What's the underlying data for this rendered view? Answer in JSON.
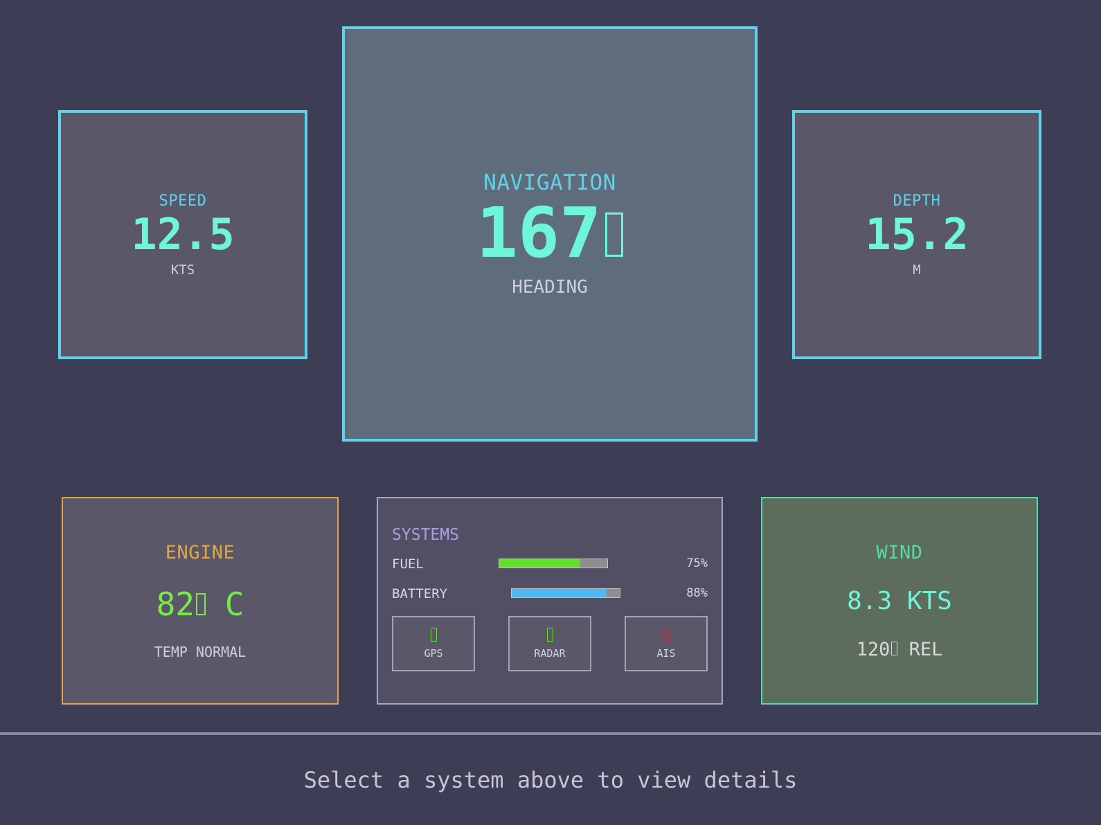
{
  "speed": {
    "label": "SPEED",
    "value": "12.5",
    "unit": "KTS"
  },
  "navigation": {
    "label": "NAVIGATION",
    "value": "167",
    "unit": "HEADING"
  },
  "depth": {
    "label": "DEPTH",
    "value": "15.2",
    "unit": "M"
  },
  "engine": {
    "label": "ENGINE",
    "value_num": "82",
    "value_unit": " C",
    "status": "TEMP NORMAL",
    "accent": "#e0a640"
  },
  "systems": {
    "title": "SYSTEMS",
    "meters": [
      {
        "label": "FUEL",
        "percent_label": "75%",
        "level": 0.75,
        "color": "#5fe12b"
      },
      {
        "label": "BATTERY",
        "percent_label": "88%",
        "level": 0.88,
        "color": "#50b8f0"
      }
    ],
    "statuses": [
      {
        "label": "GPS",
        "icon": "status-ok-icon",
        "color": "#5fe12b"
      },
      {
        "label": "RADAR",
        "icon": "status-ok-icon",
        "color": "#5fe12b"
      },
      {
        "label": "AIS",
        "icon": "status-fault-icon",
        "color": "#c03038"
      }
    ]
  },
  "wind": {
    "label": "WIND",
    "speed": "8.3 KTS",
    "direction_num": "120",
    "direction_suffix": " REL",
    "accent": "#58d9a8"
  },
  "footer": {
    "prompt": "Select a system above to view details"
  }
}
